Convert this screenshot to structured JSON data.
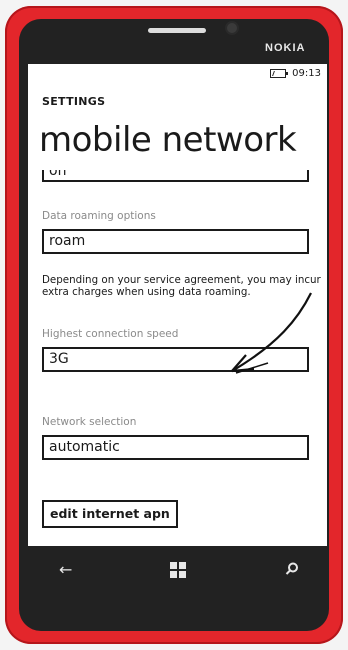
{
  "device": {
    "brand": "NOKIA"
  },
  "status_bar": {
    "time": "09:13",
    "battery_icon": "battery-charging-icon"
  },
  "header": {
    "section": "SETTINGS",
    "title": "mobile network"
  },
  "fields": {
    "data_connection": {
      "value": "on"
    },
    "data_roaming": {
      "label": "Data roaming options",
      "value": "roam"
    },
    "roaming_note": "Depending on your service agreement, you may incur extra charges when using data roaming.",
    "connection_speed": {
      "label": "Highest connection speed",
      "value": "3G"
    },
    "network_selection": {
      "label": "Network selection",
      "value": "automatic"
    }
  },
  "buttons": {
    "edit_apn": "edit internet apn"
  },
  "nav": {
    "back_icon": "back-arrow-icon",
    "start_icon": "windows-logo-icon",
    "search_icon": "search-icon"
  },
  "colors": {
    "phone_body": "#e3262b",
    "screen_bg": "#ffffff",
    "text": "#1a1a1a",
    "label": "#8a8a8a"
  }
}
